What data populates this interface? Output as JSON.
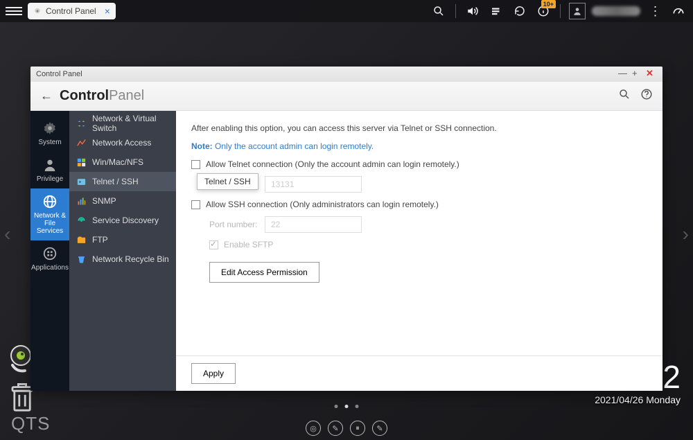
{
  "taskbar": {
    "tab_label": "Control Panel",
    "notif_badge": "10+"
  },
  "desktop": {
    "clock_big": "2",
    "date_line": "2021/04/26 Monday",
    "brand": "QTS"
  },
  "window": {
    "titlebar": "Control Panel",
    "header_bold": "Control",
    "header_light": "Panel"
  },
  "sidebar1": {
    "system": "System",
    "privilege": "Privilege",
    "network": "Network & File Services",
    "applications": "Applications"
  },
  "sidebar2": {
    "items": [
      "Network & Virtual Switch",
      "Network Access",
      "Win/Mac/NFS",
      "Telnet / SSH",
      "SNMP",
      "Service Discovery",
      "FTP",
      "Network Recycle Bin"
    ]
  },
  "tooltip": "Telnet / SSH",
  "content": {
    "intro": "After enabling this option, you can access this server via Telnet or SSH connection.",
    "note_label": "Note:",
    "note_text": "Only the account admin can login remotely.",
    "telnet_label": "Allow Telnet connection (Only the account admin can login remotely.)",
    "port_label": "Port number:",
    "telnet_port": "13131",
    "ssh_label": "Allow SSH connection (Only administrators can login remotely.)",
    "ssh_port": "22",
    "sftp_label": "Enable SFTP",
    "edit_btn": "Edit Access Permission",
    "apply_btn": "Apply"
  }
}
